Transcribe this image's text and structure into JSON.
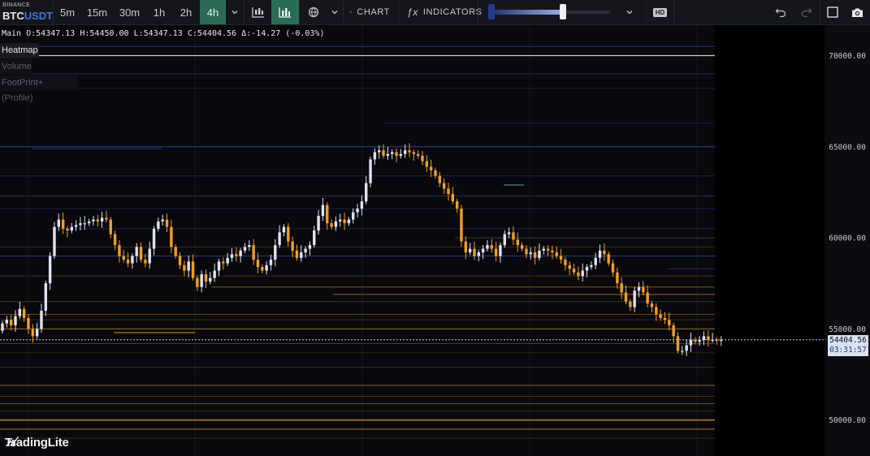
{
  "symbol": {
    "exchange": "BINANCE",
    "pair": "BTCUSDT"
  },
  "timeframes": [
    {
      "label": "5m",
      "active": false
    },
    {
      "label": "15m",
      "active": false
    },
    {
      "label": "30m",
      "active": false
    },
    {
      "label": "1h",
      "active": false
    },
    {
      "label": "2h",
      "active": false
    },
    {
      "label": "4h",
      "active": true
    }
  ],
  "toolbar": {
    "chart_label": "CHART",
    "indicators_label": "INDICATORS",
    "hd_label": "HD",
    "heatmap_contrast": 0.62
  },
  "ohlc": {
    "name": "Main",
    "open": "O:54347.13",
    "high": "H:54450.00",
    "low": "L:54347.13",
    "close": "C:54404.56",
    "change": "Δ:-14.27 (-0.03%)"
  },
  "indicators": [
    {
      "label": "Heatmap",
      "enabled": true
    },
    {
      "label": "Volume",
      "enabled": false
    },
    {
      "label": "FootPrint+ (Profile)",
      "enabled": false
    }
  ],
  "price_axis": {
    "ticks": [
      "70000.00",
      "65000.00",
      "60000.00",
      "55000.00",
      "50000.00"
    ],
    "tick_values": [
      70000,
      65000,
      60000,
      55000,
      50000
    ]
  },
  "last_price": {
    "price": "54404.56",
    "countdown": "03:31:57",
    "value": 54404.56
  },
  "colors": {
    "up": "#dfe3f1",
    "down": "#f0a020",
    "accent": "#2a6b57",
    "background": "#08080d"
  },
  "brand": "TradingLite"
}
